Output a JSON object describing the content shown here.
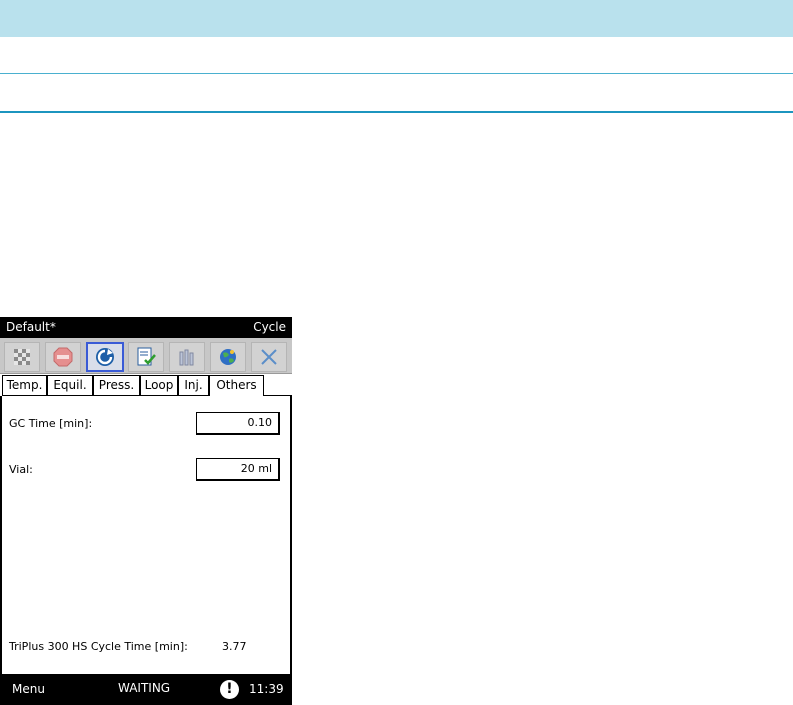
{
  "device": {
    "title": "Default*",
    "mode": "Cycle",
    "toolbar": [
      {
        "icon": "checkered-flag-icon"
      },
      {
        "icon": "stop-sign-icon"
      },
      {
        "icon": "cycle-refresh-icon",
        "active": true
      },
      {
        "icon": "checklist-icon"
      },
      {
        "icon": "vials-icon"
      },
      {
        "icon": "globe-icon"
      },
      {
        "icon": "close-icon"
      }
    ],
    "tabs": [
      "Temp.",
      "Equil.",
      "Press.",
      "Loop",
      "Inj.",
      "Others"
    ],
    "selected_tab": "Others",
    "form": {
      "gc_time_label": "GC Time [min]:",
      "gc_time_value": "0.10",
      "vial_label": "Vial:",
      "vial_value": "20 ml",
      "cycle_time_label": "TriPlus 300 HS Cycle Time [min]:",
      "cycle_time_value": "3.77"
    },
    "status": {
      "menu": "Menu",
      "state": "WAITING",
      "alert": "!",
      "clock": "11:39"
    }
  },
  "colors": {
    "header_band": "#b9e1ed",
    "rule": "#1c95bf",
    "active_button_border": "#3a5bd6"
  }
}
